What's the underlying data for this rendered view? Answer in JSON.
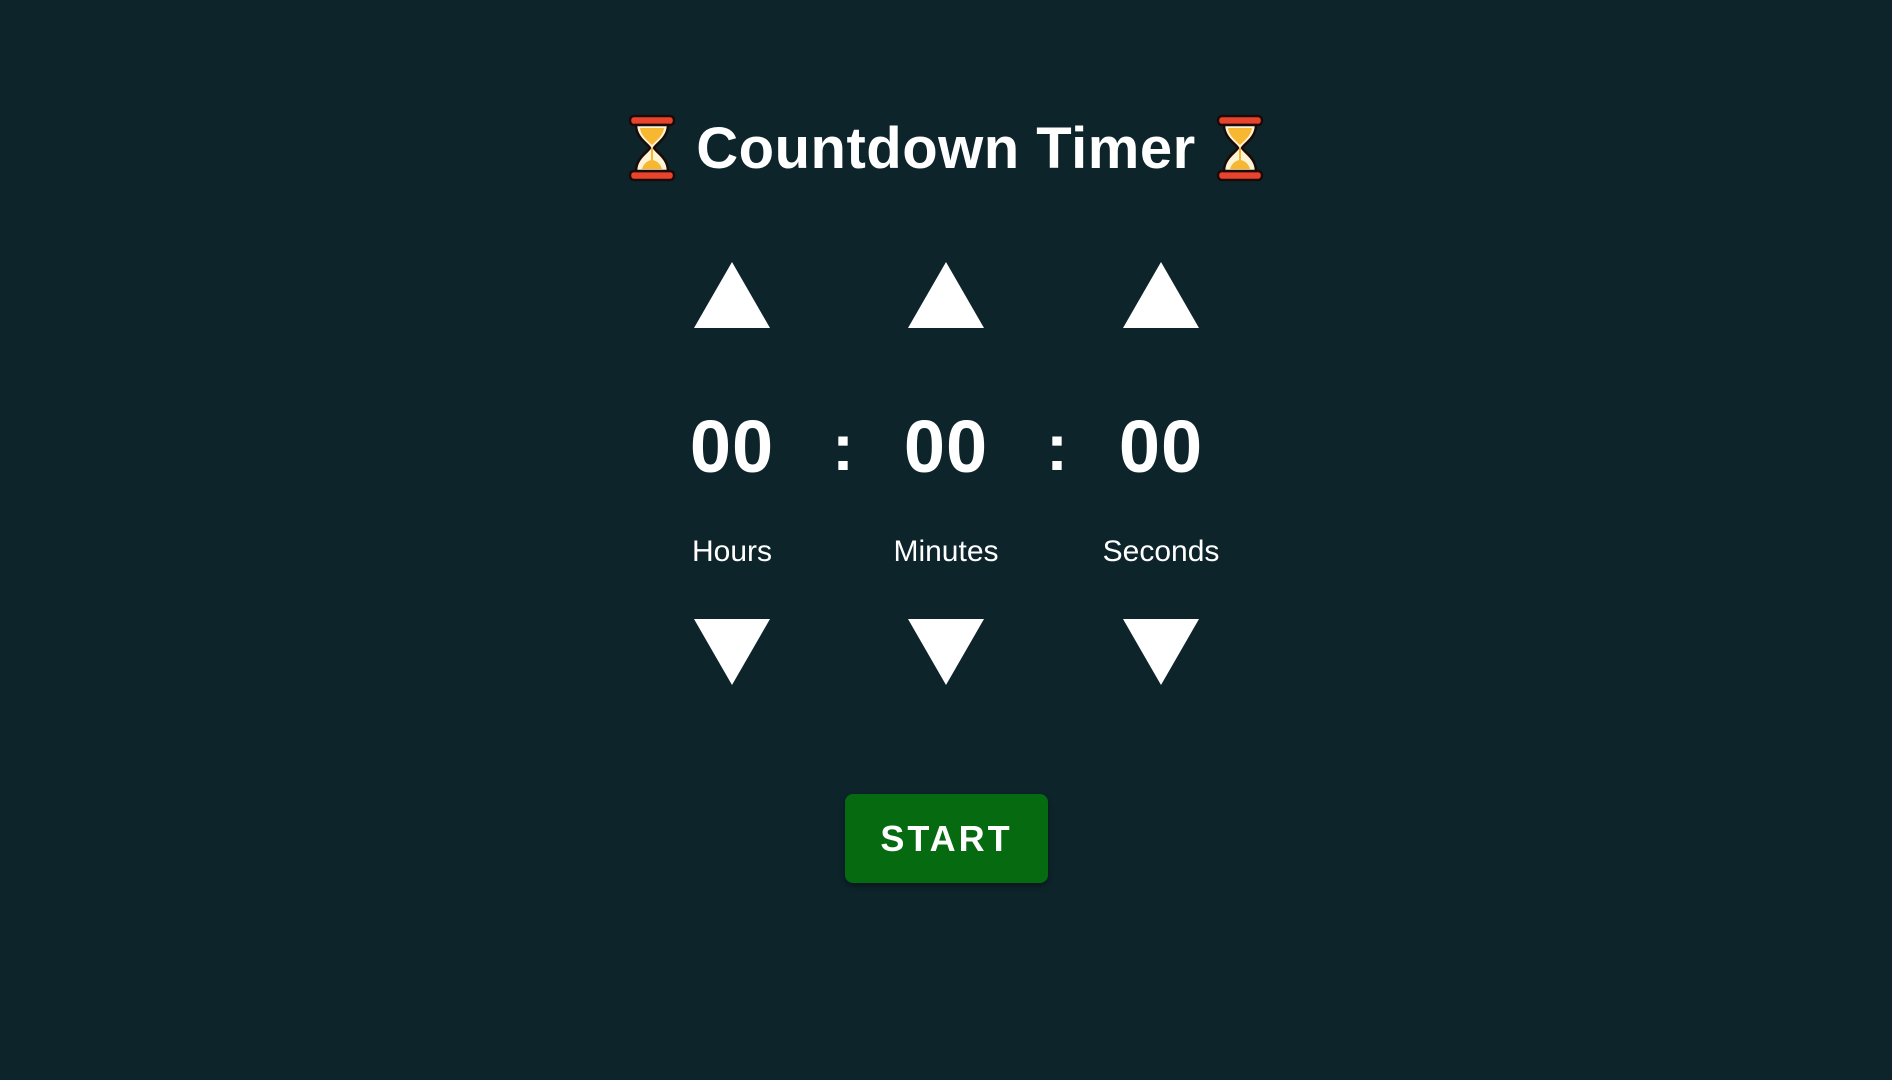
{
  "app": {
    "title": "Countdown Timer",
    "title_icon": "hourglass-icon"
  },
  "timer": {
    "separator": ":",
    "units": [
      {
        "id": "hours",
        "value": "00",
        "label": "Hours",
        "up_icon": "triangle-up-icon",
        "down_icon": "triangle-down-icon"
      },
      {
        "id": "minutes",
        "value": "00",
        "label": "Minutes",
        "up_icon": "triangle-up-icon",
        "down_icon": "triangle-down-icon"
      },
      {
        "id": "seconds",
        "value": "00",
        "label": "Seconds",
        "up_icon": "triangle-up-icon",
        "down_icon": "triangle-down-icon"
      }
    ]
  },
  "controls": {
    "start_label": "START"
  },
  "colors": {
    "background": "#0d242b",
    "text": "#ffffff",
    "start_button": "#056a10",
    "hourglass_frame": "#e8442d",
    "hourglass_sand": "#f7b731"
  }
}
